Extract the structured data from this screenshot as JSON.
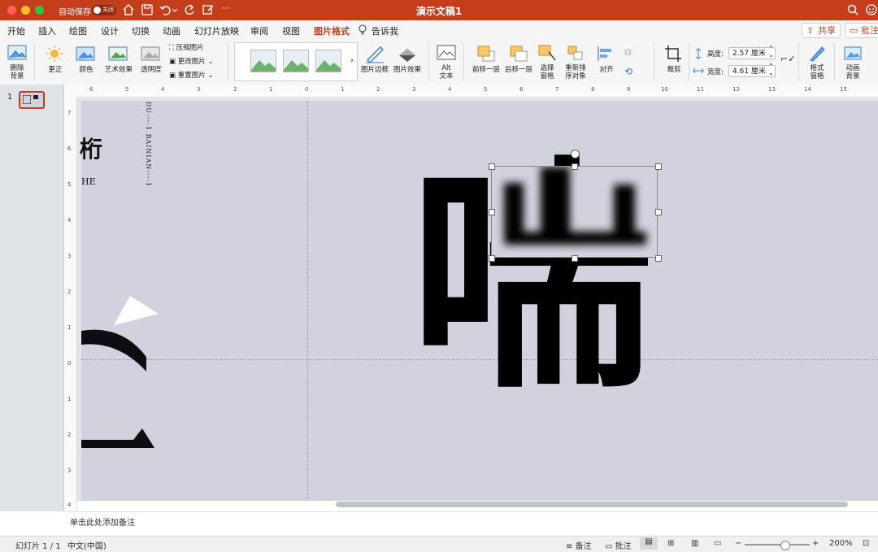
{
  "titlebar": {
    "autosave_label": "自动保存",
    "autosave_toggle": "关闭",
    "document_title": "演示文稿1",
    "colors": {
      "bar": "#c43e1c",
      "close": "#ff5f57",
      "minimize": "#febc2e",
      "maximize": "#28c840"
    }
  },
  "tabs": {
    "items": [
      "开始",
      "插入",
      "绘图",
      "设计",
      "切换",
      "动画",
      "幻灯片放映",
      "审阅",
      "视图",
      "图片格式"
    ],
    "active": "图片格式",
    "tell_me": "告诉我",
    "share": "共享",
    "comments": "批注"
  },
  "ribbon": {
    "remove_background": [
      "删除",
      "背景"
    ],
    "corrections": "更正",
    "color": "颜色",
    "artistic_effects": "艺术效果",
    "transparency": "透明度",
    "compress": "压缩图片",
    "change": "更改图片",
    "reset": "重置图片",
    "picture_border": "图片边框",
    "picture_effects": "图片效果",
    "alt_text": [
      "Alt",
      "文本"
    ],
    "bring_forward": "前移一层",
    "send_backward": "后移一层",
    "selection_pane": [
      "选择",
      "窗格"
    ],
    "reorder": [
      "重新排",
      "序对象"
    ],
    "align": "对齐",
    "crop": "裁剪",
    "height_label": "高度:",
    "height_value": "2.57 厘米",
    "width_label": "宽度:",
    "width_value": "4.61 厘米",
    "format_pane": [
      "格式",
      "窗格"
    ],
    "animate_background": [
      "动画",
      "背景"
    ]
  },
  "ruler": {
    "top": [
      "6",
      "5",
      "4",
      "3",
      "2",
      "1",
      "0",
      "1",
      "2",
      "3",
      "4",
      "5",
      "6",
      "7",
      "8",
      "9",
      "10",
      "11",
      "12",
      "13",
      "14",
      "15"
    ],
    "left": [
      "7",
      "6",
      "5",
      "4",
      "3",
      "2",
      "1",
      "0",
      "1",
      "2",
      "3",
      "4"
    ]
  },
  "thumbnails": {
    "slide_number": "1"
  },
  "slide": {
    "left_char": "桁",
    "left_small": "HE",
    "vertical_text": "DU----1  BAINIAN----1",
    "main_char": "喘"
  },
  "notes": {
    "placeholder": "单击此处添加备注"
  },
  "status": {
    "slide_info": "幻灯片 1 / 1",
    "language": "中文(中国)",
    "notes_label": "备注",
    "comments_label": "批注",
    "zoom": "200%"
  }
}
